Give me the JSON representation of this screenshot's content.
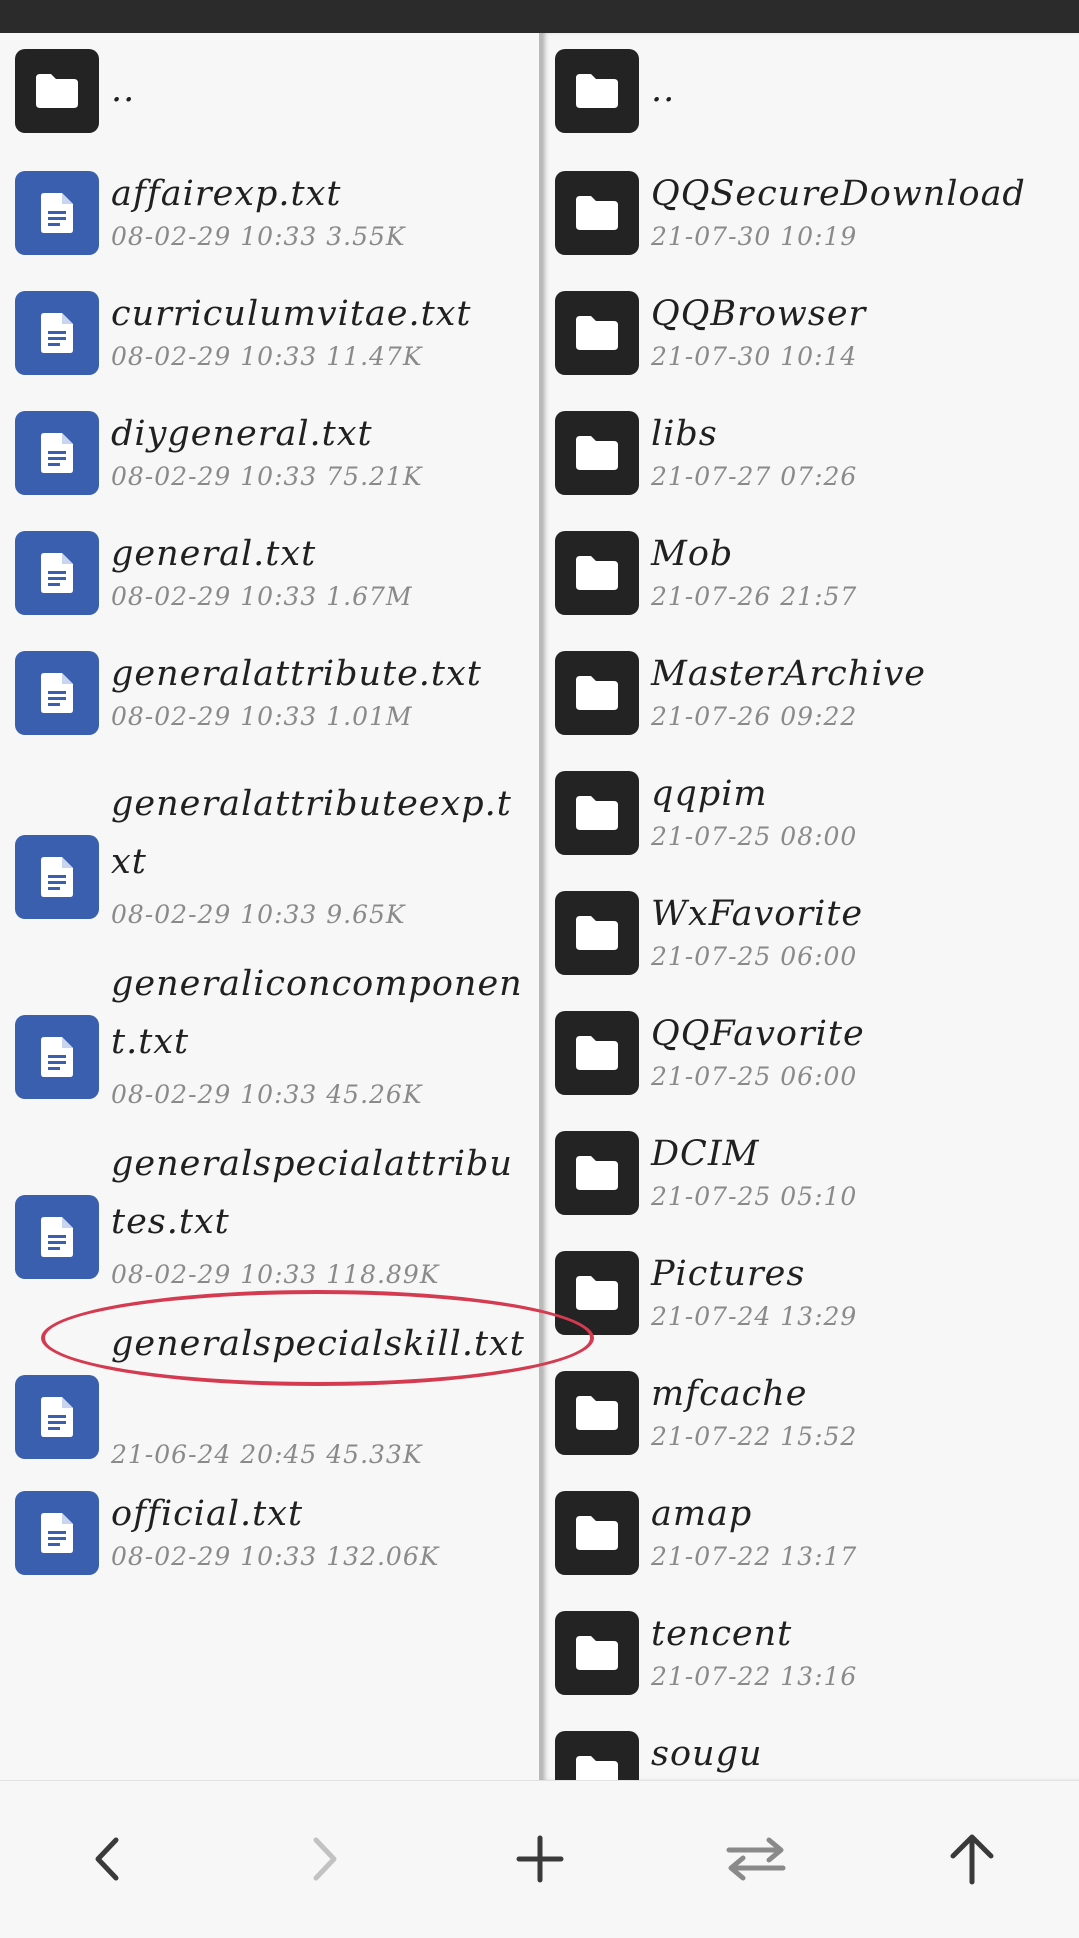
{
  "colors": {
    "folder_icon_bg": "#232323",
    "file_icon_bg": "#3a5fae",
    "highlight": "#d43a50"
  },
  "left_panel": {
    "items": [
      {
        "type": "folder",
        "icon": "folder-icon",
        "name": "..",
        "meta": ""
      },
      {
        "type": "file",
        "icon": "document-icon",
        "name": "affairexp.txt",
        "meta": "08-02-29 10:33 3.55K"
      },
      {
        "type": "file",
        "icon": "document-icon",
        "name": "curriculumvitae.txt",
        "meta": "08-02-29 10:33 11.47K"
      },
      {
        "type": "file",
        "icon": "document-icon",
        "name": "diygeneral.txt",
        "meta": "08-02-29 10:33 75.21K"
      },
      {
        "type": "file",
        "icon": "document-icon",
        "name": "general.txt",
        "meta": "08-02-29 10:33 1.67M"
      },
      {
        "type": "file",
        "icon": "document-icon",
        "name": "generalattribute.txt",
        "meta": "08-02-29 10:33 1.01M"
      },
      {
        "type": "file",
        "icon": "document-icon",
        "name": "generalattributeexp.txt",
        "meta": "08-02-29 10:33 9.65K"
      },
      {
        "type": "file",
        "icon": "document-icon",
        "name": "generaliconcomponent.txt",
        "meta": "08-02-29 10:33 45.26K"
      },
      {
        "type": "file",
        "icon": "document-icon",
        "name": "generalspecialattributes.txt",
        "meta": "08-02-29 10:33 118.89K"
      },
      {
        "type": "file",
        "icon": "document-icon",
        "name": "generalspecialskill.txt",
        "meta": "21-06-24 20:45 45.33K"
      },
      {
        "type": "file",
        "icon": "document-icon",
        "name": "official.txt",
        "meta": "08-02-29 10:33 132.06K"
      }
    ]
  },
  "right_panel": {
    "items": [
      {
        "type": "folder",
        "icon": "folder-icon",
        "name": "..",
        "meta": ""
      },
      {
        "type": "folder",
        "icon": "folder-icon",
        "name": "QQSecureDownload",
        "meta": "21-07-30 10:19"
      },
      {
        "type": "folder",
        "icon": "folder-icon",
        "name": "QQBrowser",
        "meta": "21-07-30 10:14"
      },
      {
        "type": "folder",
        "icon": "folder-icon",
        "name": "libs",
        "meta": "21-07-27 07:26"
      },
      {
        "type": "folder",
        "icon": "folder-icon",
        "name": "Mob",
        "meta": "21-07-26 21:57"
      },
      {
        "type": "folder",
        "icon": "folder-icon",
        "name": "MasterArchive",
        "meta": "21-07-26 09:22"
      },
      {
        "type": "folder",
        "icon": "folder-icon",
        "name": "qqpim",
        "meta": "21-07-25 08:00"
      },
      {
        "type": "folder",
        "icon": "folder-icon",
        "name": "WxFavorite",
        "meta": "21-07-25 06:00"
      },
      {
        "type": "folder",
        "icon": "folder-icon",
        "name": "QQFavorite",
        "meta": "21-07-25 06:00"
      },
      {
        "type": "folder",
        "icon": "folder-icon",
        "name": "DCIM",
        "meta": "21-07-25 05:10"
      },
      {
        "type": "folder",
        "icon": "folder-icon",
        "name": "Pictures",
        "meta": "21-07-24 13:29"
      },
      {
        "type": "folder",
        "icon": "folder-icon",
        "name": "mfcache",
        "meta": "21-07-22 15:52"
      },
      {
        "type": "folder",
        "icon": "folder-icon",
        "name": "amap",
        "meta": "21-07-22 13:17"
      },
      {
        "type": "folder",
        "icon": "folder-icon",
        "name": "tencent",
        "meta": "21-07-22 13:16"
      },
      {
        "type": "folder",
        "icon": "folder-icon",
        "name": "sougu",
        "meta": ""
      }
    ]
  },
  "bottom_bar": {
    "buttons": [
      {
        "icon": "chevron-left-icon",
        "enabled": true
      },
      {
        "icon": "chevron-right-icon",
        "enabled": false
      },
      {
        "icon": "plus-icon",
        "enabled": true
      },
      {
        "icon": "swap-icon",
        "enabled": true
      },
      {
        "icon": "arrow-up-icon",
        "enabled": true
      }
    ]
  }
}
